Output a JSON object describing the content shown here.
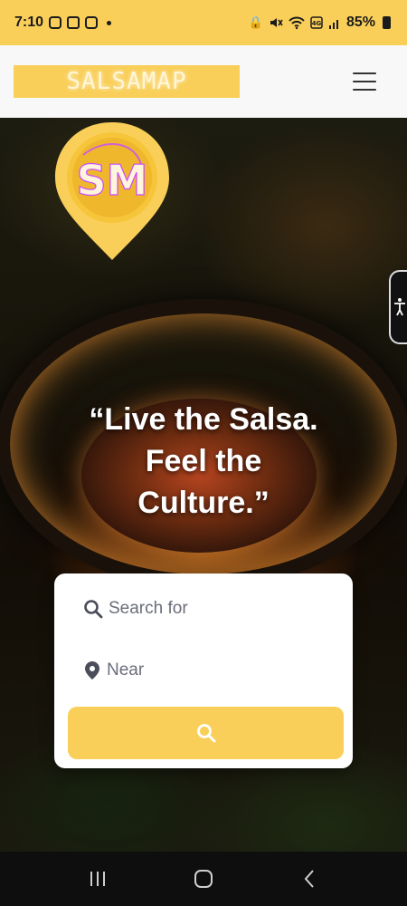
{
  "status_bar": {
    "time": "7:10",
    "battery_text": "85%",
    "icons": [
      "instagram-icon",
      "gallery-icon",
      "instagram-icon",
      "dot-icon",
      "lock-icon",
      "mute-icon",
      "wifi-icon",
      "lte-icon",
      "signal-icon",
      "battery-icon"
    ]
  },
  "header": {
    "logo_text": "SALSAMAP",
    "menu_icon": "hamburger-menu-icon"
  },
  "pin_logo": {
    "monogram": "SM"
  },
  "hero": {
    "tagline_line1": "“Live the Salsa.",
    "tagline_line2": "Feel the",
    "tagline_line3": "Culture.”"
  },
  "search": {
    "search_placeholder": "Search for",
    "near_placeholder": "Near",
    "search_icon": "search-icon",
    "location_icon": "map-pin-icon",
    "button_icon": "search-icon"
  },
  "nav": {
    "recent_icon": "recent-apps-icon",
    "home_icon": "home-icon",
    "back_icon": "back-icon"
  },
  "colors": {
    "brand_yellow": "#f9cf59",
    "header_bg": "#f8f8f8",
    "card_bg": "#ffffff",
    "placeholder": "#6b6e7a"
  }
}
